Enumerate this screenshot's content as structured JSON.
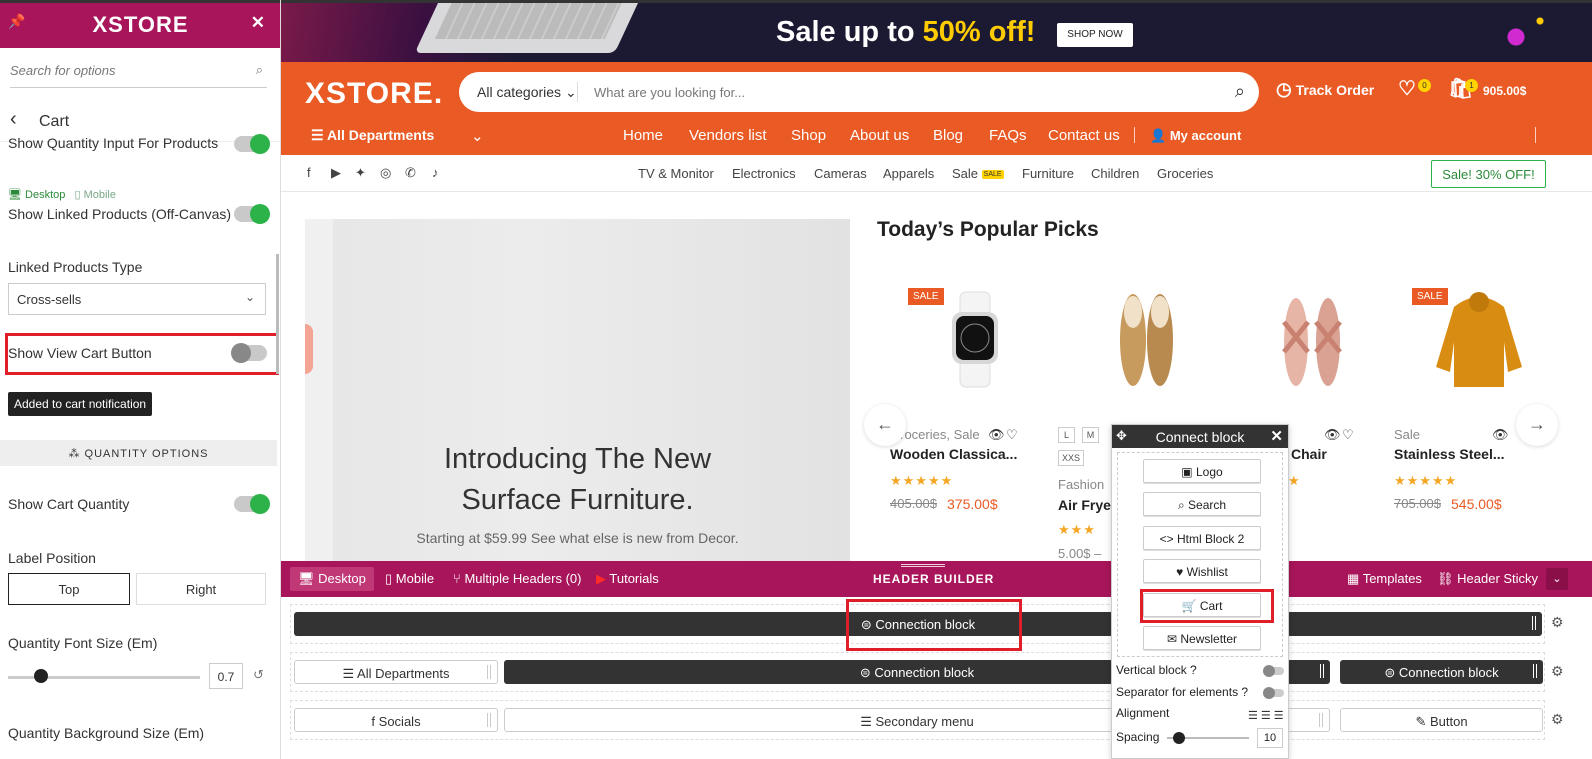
{
  "panel": {
    "brand": "XSTORE",
    "search_placeholder": "Search for options",
    "section_title": "Cart",
    "options": {
      "qty_input_products": "Show Quantity Input For Products",
      "device_desktop": "Desktop",
      "device_mobile": "Mobile",
      "linked_offcanvas": "Show Linked Products (Off-Canvas)",
      "linked_type_label": "Linked Products Type",
      "linked_type_value": "Cross-sells",
      "view_cart_label": "Show View Cart Button",
      "notification_button": "Added to cart notification",
      "quantity_section": "QUANTITY OPTIONS",
      "cart_quantity_label": "Show Cart Quantity",
      "label_position": "Label Position",
      "pos_top": "Top",
      "pos_right": "Right",
      "font_size_label": "Quantity Font Size (Em)",
      "font_size_value": "0.7",
      "font_size_level": 0.17,
      "bg_size_label": "Quantity Background Size (Em)"
    },
    "toggles": {
      "qty_input": true,
      "linked_offcanvas": true,
      "view_cart": false,
      "cart_quantity": true
    }
  },
  "banner": {
    "sale_prefix": "Sale up to ",
    "sale_highlight": "50% off!",
    "shop_now": "SHOP NOW"
  },
  "header": {
    "logo": "XSTORE.",
    "category": "All categories",
    "search_placeholder": "What are you looking for...",
    "track_order": "Track Order",
    "wishlist_count": "0",
    "cart_count": "1",
    "cart_total": "905.00$",
    "departments": "All Departments",
    "nav": [
      "Home",
      "Vendors list",
      "Shop",
      "About us",
      "Blog",
      "FAQs",
      "Contact us"
    ],
    "account": "My account"
  },
  "subnav": {
    "categories": [
      "TV & Monitor",
      "Electronics",
      "Cameras",
      "Apparels",
      "Sale",
      "Furniture",
      "Children",
      "Groceries"
    ],
    "sale_tag": "SALE",
    "promo": "Sale! 30% OFF!"
  },
  "hero": {
    "headline_1": "Introducing The New",
    "headline_2": "Surface Furniture.",
    "subtext": "Starting at $59.99 See what else is new from Decor."
  },
  "popular": {
    "title": "Today’s Popular Picks",
    "sale_badge": "SALE",
    "products": [
      {
        "category": "Groceries, Sale",
        "name": "Wooden Classica...",
        "stars": "★★★★★",
        "old_price": "405.00$",
        "new_price": "375.00$"
      },
      {
        "category": "Fashion",
        "name": "Air Fryer",
        "stars": "★★★",
        "price": "5.00$ –",
        "sizes": [
          "L",
          "M",
          "XXS"
        ]
      },
      {
        "name": "Chair",
        "stars": "★"
      },
      {
        "category": "Sale",
        "name": "Stainless Steel...",
        "stars": "★★★★★",
        "old_price": "705.00$",
        "new_price": "545.00$"
      }
    ]
  },
  "builder": {
    "desktop": "Desktop",
    "mobile": "Mobile",
    "multiple_headers": "Multiple Headers (0)",
    "tutorials": "Tutorials",
    "title": "HEADER BUILDER",
    "templates": "Templates",
    "sticky": "Header Sticky",
    "connection_block": "Connection block",
    "all_departments": "All Departments",
    "socials": "Socials",
    "secondary_menu": "Secondary menu",
    "button": "Button"
  },
  "connect_popup": {
    "title": "Connect block",
    "items": [
      "Logo",
      "Search",
      "Html Block 2",
      "Wishlist",
      "Cart",
      "Newsletter"
    ],
    "vertical": "Vertical block ?",
    "separator": "Separator for elements ?",
    "alignment": "Alignment",
    "spacing": "Spacing",
    "spacing_value": "10",
    "spacing_level": 0.1
  },
  "colors": {
    "brand": "#a8155a",
    "orange": "#e95a24",
    "toggle_on": "#2bb34a",
    "highlight": "#e01e2a"
  }
}
